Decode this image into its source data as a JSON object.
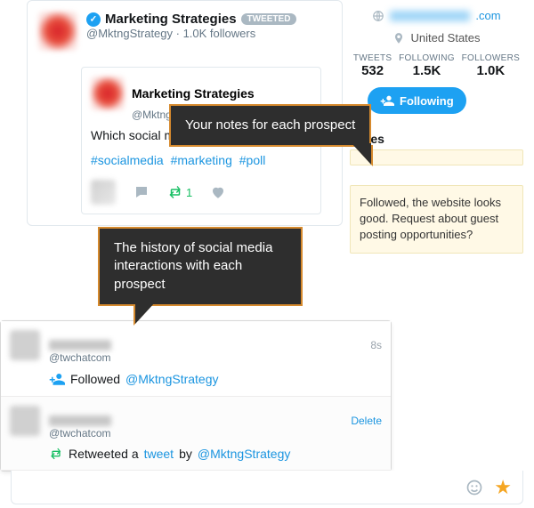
{
  "profile": {
    "name": "Marketing Strategies",
    "badge": "TWEETED",
    "handle": "@MktngStrategy",
    "followers_meta": "1.0K followers"
  },
  "tweet": {
    "author": "Marketing Strategies",
    "handle": "@MktngStrategy",
    "text": "Which social media pla",
    "hashtags": [
      "#socialmedia",
      "#marketing",
      "#poll"
    ],
    "retweet_count": "1"
  },
  "side": {
    "website_suffix": ".com",
    "location": "United States",
    "stats": {
      "tweets_label": "TWEETS",
      "tweets": "532",
      "following_label": "FOLLOWING",
      "following": "1.5K",
      "followers_label": "FOLLOWERS",
      "followers": "1.0K"
    },
    "follow_button": "Following",
    "notes_header": "Notes",
    "notes_body": "Followed, the website looks good. Request about guest posting opportunities?"
  },
  "callouts": {
    "notes": "Your notes for each prospect",
    "history": "The history of social media interactions with each prospect"
  },
  "history": [
    {
      "handle": "@twchatcom",
      "time": "8s",
      "verb": "Followed",
      "target": "@MktngStrategy"
    },
    {
      "handle": "@twchatcom",
      "delete": "Delete",
      "verb": "Retweeted a",
      "link_word": "tweet",
      "by": "by",
      "target": "@MktngStrategy"
    }
  ]
}
